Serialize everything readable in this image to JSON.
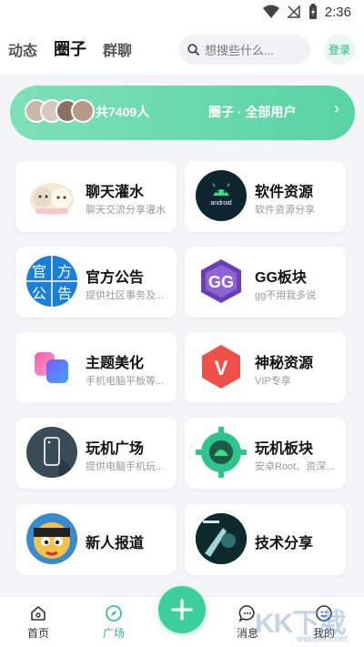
{
  "status_bar": {
    "time": "2:36"
  },
  "header": {
    "tabs": [
      {
        "label": "动态"
      },
      {
        "label": "圈子"
      },
      {
        "label": "群聊"
      }
    ],
    "search_placeholder": "想搜些什么...",
    "login_label": "登录"
  },
  "banner": {
    "member_count": "共7409人",
    "title": "圈子 · 全部用户",
    "arrow": "›"
  },
  "cards": [
    {
      "title": "聊天灌水",
      "subtitle": "聊天交流分享灌水"
    },
    {
      "title": "软件资源",
      "subtitle": "软件资源分享",
      "icon_text": "android"
    },
    {
      "title": "官方公告",
      "subtitle": "提供社区事务及...",
      "icon_text": "官方公告"
    },
    {
      "title": "GG板块",
      "subtitle": "gg不用我多说",
      "icon_text": "GG"
    },
    {
      "title": "主题美化",
      "subtitle": "手机电脑平板等..."
    },
    {
      "title": "神秘资源",
      "subtitle": "VIP专享",
      "icon_text": "V"
    },
    {
      "title": "玩机广场",
      "subtitle": "提供电脑手机玩..."
    },
    {
      "title": "玩机板块",
      "subtitle": "安卓Root、资深..."
    },
    {
      "title": "新人报道",
      "subtitle": ""
    },
    {
      "title": "技术分享",
      "subtitle": ""
    }
  ],
  "bottom_nav": [
    {
      "label": "首页"
    },
    {
      "label": "广场"
    },
    {
      "label": "消息"
    },
    {
      "label": "我的"
    }
  ],
  "fab_symbol": "+",
  "watermark": {
    "text": "KK下载",
    "url": "www.kkx.net"
  },
  "colors": {
    "accent": "#3ccf9c",
    "banner": "#6adbb0",
    "background": "#f4f5f7"
  }
}
